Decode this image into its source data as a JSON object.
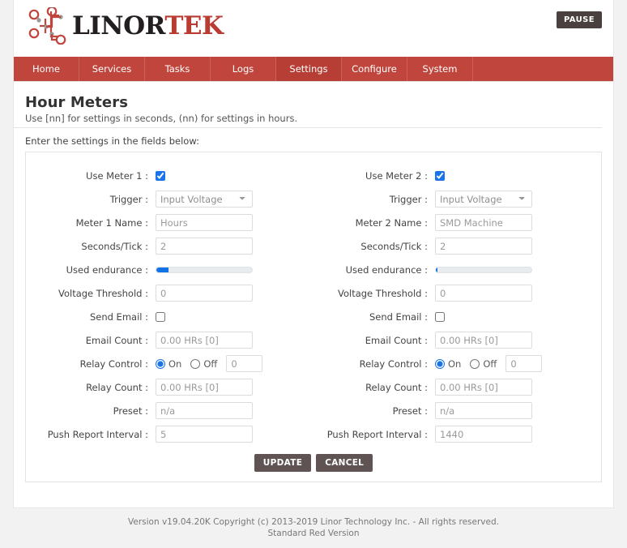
{
  "brand": {
    "name_dark": "LINOR",
    "name_red": "TEK",
    "logo_icon": "linortek-circuit-logo",
    "accent_red": "#c0453c",
    "accent_blue": "#1173e6"
  },
  "header": {
    "pause_label": "PAUSE"
  },
  "nav": {
    "items": [
      {
        "label": "Home",
        "active": false
      },
      {
        "label": "Services",
        "active": false
      },
      {
        "label": "Tasks",
        "active": false
      },
      {
        "label": "Logs",
        "active": false
      },
      {
        "label": "Settings",
        "active": true
      },
      {
        "label": "Configure",
        "active": false
      },
      {
        "label": "System",
        "active": false
      }
    ]
  },
  "page": {
    "title": "Hour Meters",
    "subtitle": "Use [nn] for settings in seconds, (nn) for settings in hours.",
    "instruction": "Enter the settings in the fields below:"
  },
  "meter1": {
    "use_label": "Use Meter 1 :",
    "use_checked": true,
    "trigger_label": "Trigger :",
    "trigger_value": "Input Voltage",
    "trigger_options": [
      "Input Voltage"
    ],
    "name_label": "Meter 1 Name :",
    "name_value": "Hours",
    "seconds_label": "Seconds/Tick :",
    "seconds_value": "2",
    "endurance_label": "Used endurance :",
    "endurance_percent": 13,
    "voltage_label": "Voltage Threshold :",
    "voltage_value": "0",
    "send_email_label": "Send Email :",
    "send_email_checked": false,
    "email_count_label": "Email Count :",
    "email_count_value": "0.00 HRs [0]",
    "relay_label": "Relay Control :",
    "relay_on_label": "On",
    "relay_off_label": "Off",
    "relay_state": "on",
    "relay_value": "0",
    "relay_count_label": "Relay Count :",
    "relay_count_value": "0.00 HRs [0]",
    "preset_label": "Preset :",
    "preset_value": "n/a",
    "push_label": "Push Report Interval :",
    "push_value": "5"
  },
  "meter2": {
    "use_label": "Use Meter 2 :",
    "use_checked": true,
    "trigger_label": "Trigger :",
    "trigger_value": "Input Voltage",
    "trigger_options": [
      "Input Voltage"
    ],
    "name_label": "Meter 2 Name :",
    "name_value": "SMD Machine",
    "seconds_label": "Seconds/Tick :",
    "seconds_value": "2",
    "endurance_label": "Used endurance :",
    "endurance_percent": 2,
    "voltage_label": "Voltage Threshold :",
    "voltage_value": "0",
    "send_email_label": "Send Email :",
    "send_email_checked": false,
    "email_count_label": "Email Count :",
    "email_count_value": "0.00 HRs [0]",
    "relay_label": "Relay Control :",
    "relay_on_label": "On",
    "relay_off_label": "Off",
    "relay_state": "on",
    "relay_value": "0",
    "relay_count_label": "Relay Count :",
    "relay_count_value": "0.00 HRs [0]",
    "preset_label": "Preset :",
    "preset_value": "n/a",
    "push_label": "Push Report Interval :",
    "push_value": "1440"
  },
  "actions": {
    "update_label": "UPDATE",
    "cancel_label": "CANCEL"
  },
  "footer": {
    "line1": "Version v19.04.20K Copyright (c) 2013-2019 Linor Technology Inc. - All rights reserved.",
    "line2": "Standard Red Version"
  }
}
